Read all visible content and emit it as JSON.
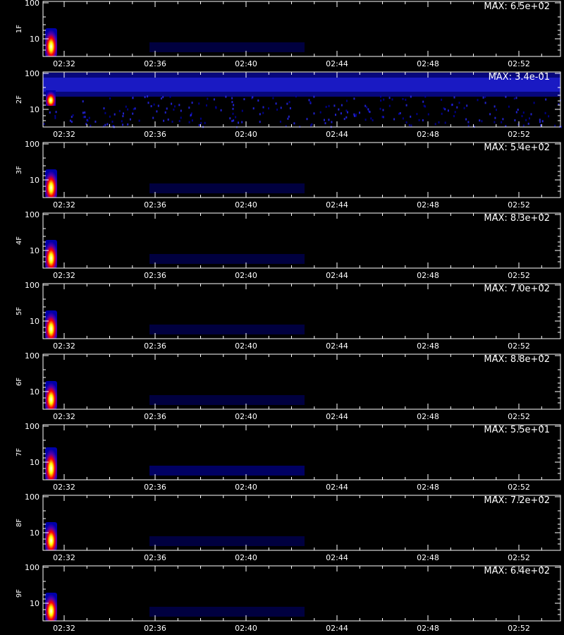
{
  "chart_data": {
    "type": "heatmap",
    "x_ticks": [
      "02:32",
      "02:36",
      "02:40",
      "02:44",
      "02:48",
      "02:52"
    ],
    "y_ticks": [
      "10",
      "100"
    ],
    "xlabel": "",
    "grid": false,
    "colors": {
      "background": "#000000",
      "axes": "#ffffff",
      "text": "#ffffff",
      "low": "#00008b",
      "mid": "#ff0000",
      "high": "#ffffff"
    },
    "panels": [
      {
        "label": "1F",
        "max_label": "MAX: 6.5e+02",
        "pattern": "burst"
      },
      {
        "label": "2F",
        "max_label": "MAX: 3.4e-01",
        "pattern": "band"
      },
      {
        "label": "3F",
        "max_label": "MAX: 5.4e+02",
        "pattern": "burst"
      },
      {
        "label": "4F",
        "max_label": "MAX: 8.3e+02",
        "pattern": "burst"
      },
      {
        "label": "5F",
        "max_label": "MAX: 7.0e+02",
        "pattern": "burst"
      },
      {
        "label": "6F",
        "max_label": "MAX: 8.8e+02",
        "pattern": "burst"
      },
      {
        "label": "7F",
        "max_label": "MAX: 5.5e+01",
        "pattern": "burst"
      },
      {
        "label": "8F",
        "max_label": "MAX: 7.2e+02",
        "pattern": "burst"
      },
      {
        "label": "9F",
        "max_label": "MAX: 6.4e+02",
        "pattern": "burst"
      }
    ]
  }
}
